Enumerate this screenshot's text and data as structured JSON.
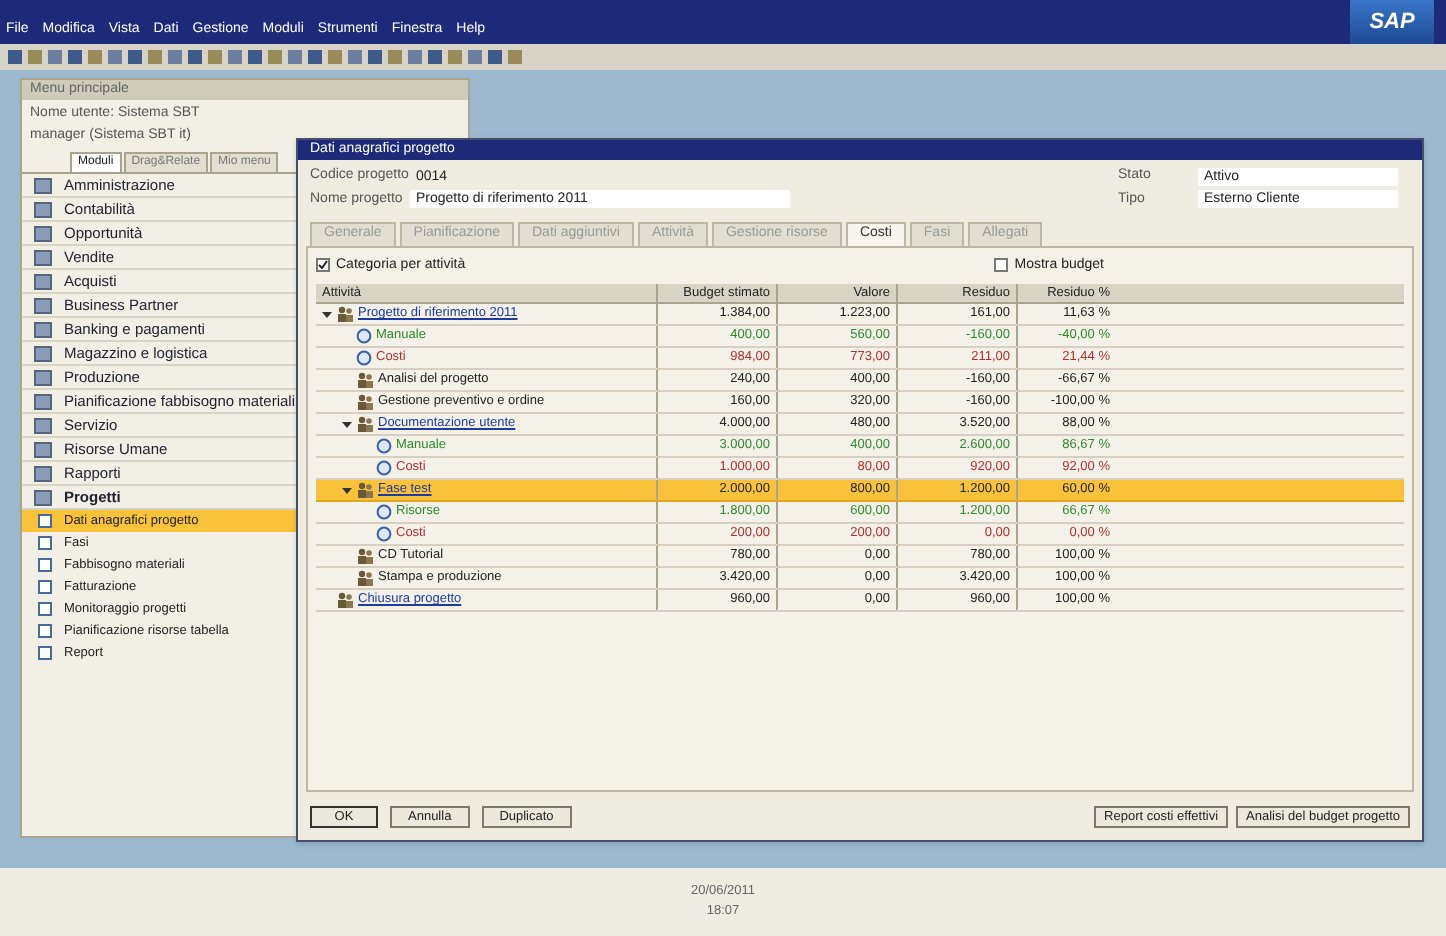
{
  "menu_bar": [
    "File",
    "Modifica",
    "Vista",
    "Dati",
    "Gestione",
    "Moduli",
    "Strumenti",
    "Finestra",
    "Help"
  ],
  "logo": "SAP",
  "main_menu": {
    "title": "Menu principale",
    "user": "Nome utente: Sistema SBT",
    "company": "manager (Sistema SBT it)",
    "tabs": [
      {
        "label": "Moduli",
        "selected": true
      },
      {
        "label": "Drag&Relate",
        "selected": false
      },
      {
        "label": "Mio menu",
        "selected": false
      }
    ],
    "items": [
      {
        "label": "Amministrazione",
        "selected": false
      },
      {
        "label": "Contabilità",
        "selected": false
      },
      {
        "label": "Opportunità",
        "selected": false
      },
      {
        "label": "Vendite",
        "selected": false
      },
      {
        "label": "Acquisti",
        "selected": false
      },
      {
        "label": "Business Partner",
        "selected": false
      },
      {
        "label": "Banking e pagamenti",
        "selected": false
      },
      {
        "label": "Magazzino e logistica",
        "selected": false
      },
      {
        "label": "Produzione",
        "selected": false
      },
      {
        "label": "Pianificazione fabbisogno materiali",
        "selected": false
      },
      {
        "label": "Servizio",
        "selected": false
      },
      {
        "label": "Risorse Umane",
        "selected": false
      },
      {
        "label": "Rapporti",
        "selected": false
      },
      {
        "label": "Progetti",
        "selected": false,
        "expanded": true,
        "children": [
          {
            "label": "Dati anagrafici progetto",
            "selected": true
          },
          {
            "label": "Fasi",
            "selected": false
          },
          {
            "label": "Fabbisogno materiali",
            "selected": false
          },
          {
            "label": "Fatturazione",
            "selected": false
          },
          {
            "label": "Monitoraggio progetti",
            "selected": false
          },
          {
            "label": "Pianificazione risorse tabella",
            "selected": false
          },
          {
            "label": "Report",
            "selected": false
          }
        ]
      }
    ]
  },
  "dialog": {
    "title": "Dati anagrafici progetto",
    "fields": [
      {
        "label": "Codice progetto",
        "value": "0014"
      },
      {
        "label": "Nome progetto",
        "value": "Progetto di riferimento 2011"
      }
    ],
    "side_fields": [
      {
        "label": "Stato",
        "value": "Attivo"
      },
      {
        "label": "Tipo",
        "value": "Esterno Cliente"
      }
    ],
    "tabs": [
      {
        "label": "Generale",
        "selected": false
      },
      {
        "label": "Pianificazione",
        "selected": false
      },
      {
        "label": "Dati aggiuntivi",
        "selected": false
      },
      {
        "label": "Attività",
        "selected": false
      },
      {
        "label": "Gestione risorse",
        "selected": false
      },
      {
        "label": "Costi",
        "selected": true
      },
      {
        "label": "Fasi",
        "selected": false
      },
      {
        "label": "Allegati",
        "selected": false
      }
    ],
    "group_checkbox": {
      "label": "Categoria per attività",
      "checked": true
    },
    "budget_checkbox": {
      "label": "Mostra budget",
      "checked": false
    },
    "columns": [
      "Attività",
      "Budget stimato",
      "Valore",
      "Residuo",
      "Residuo %"
    ],
    "rows": [
      {
        "label": "Progetto di riferimento 2011",
        "kind": "project",
        "expanded": true,
        "selected": false,
        "values": [
          "1.384,00",
          "1.223,00",
          "161,00",
          "11,63 %"
        ],
        "children": [
          {
            "label": "Manuale",
            "kind": "resource",
            "selected": false,
            "values": [
              "400,00",
              "560,00",
              "-160,00",
              "-40,00 %"
            ]
          },
          {
            "label": "Costi",
            "kind": "cost",
            "selected": false,
            "values": [
              "984,00",
              "773,00",
              "211,00",
              "21,44 %"
            ]
          },
          {
            "label": "Analisi del progetto",
            "kind": "task",
            "selected": false,
            "values": [
              "240,00",
              "400,00",
              "-160,00",
              "-66,67 %"
            ]
          },
          {
            "label": "Gestione preventivo e ordine",
            "kind": "task",
            "selected": false,
            "values": [
              "160,00",
              "320,00",
              "-160,00",
              "-100,00 %"
            ]
          },
          {
            "label": "Documentazione utente",
            "kind": "phase",
            "expanded": true,
            "selected": false,
            "values": [
              "4.000,00",
              "480,00",
              "3.520,00",
              "88,00 %"
            ],
            "children": [
              {
                "label": "Manuale",
                "kind": "resource",
                "selected": false,
                "values": [
                  "3.000,00",
                  "400,00",
                  "2.600,00",
                  "86,67 %"
                ]
              },
              {
                "label": "Costi",
                "kind": "cost",
                "selected": false,
                "values": [
                  "1.000,00",
                  "80,00",
                  "920,00",
                  "92,00 %"
                ]
              }
            ]
          },
          {
            "label": "Fase test",
            "kind": "phase",
            "expanded": true,
            "selected": true,
            "values": [
              "2.000,00",
              "800,00",
              "1.200,00",
              "60,00 %"
            ],
            "children": [
              {
                "label": "Risorse",
                "kind": "resource",
                "selected": false,
                "values": [
                  "1.800,00",
                  "600,00",
                  "1.200,00",
                  "66,67 %"
                ]
              },
              {
                "label": "Costi",
                "kind": "cost",
                "selected": false,
                "values": [
                  "200,00",
                  "200,00",
                  "0,00",
                  "0,00 %"
                ]
              }
            ]
          },
          {
            "label": "CD Tutorial",
            "kind": "task",
            "selected": false,
            "values": [
              "780,00",
              "0,00",
              "780,00",
              "100,00 %"
            ]
          },
          {
            "label": "Stampa e produzione",
            "kind": "task",
            "selected": false,
            "values": [
              "3.420,00",
              "0,00",
              "3.420,00",
              "100,00 %"
            ]
          }
        ]
      },
      {
        "label": "Chiusura progetto",
        "kind": "project",
        "selected": false,
        "values": [
          "960,00",
          "0,00",
          "960,00",
          "100,00 %"
        ]
      }
    ],
    "buttons": [
      "OK",
      "Annulla",
      "Duplicato"
    ],
    "report_buttons": [
      "Report costi effettivi",
      "Analisi del budget progetto"
    ]
  },
  "status_bar": {
    "date": "20/06/2011",
    "time": "18:07"
  }
}
